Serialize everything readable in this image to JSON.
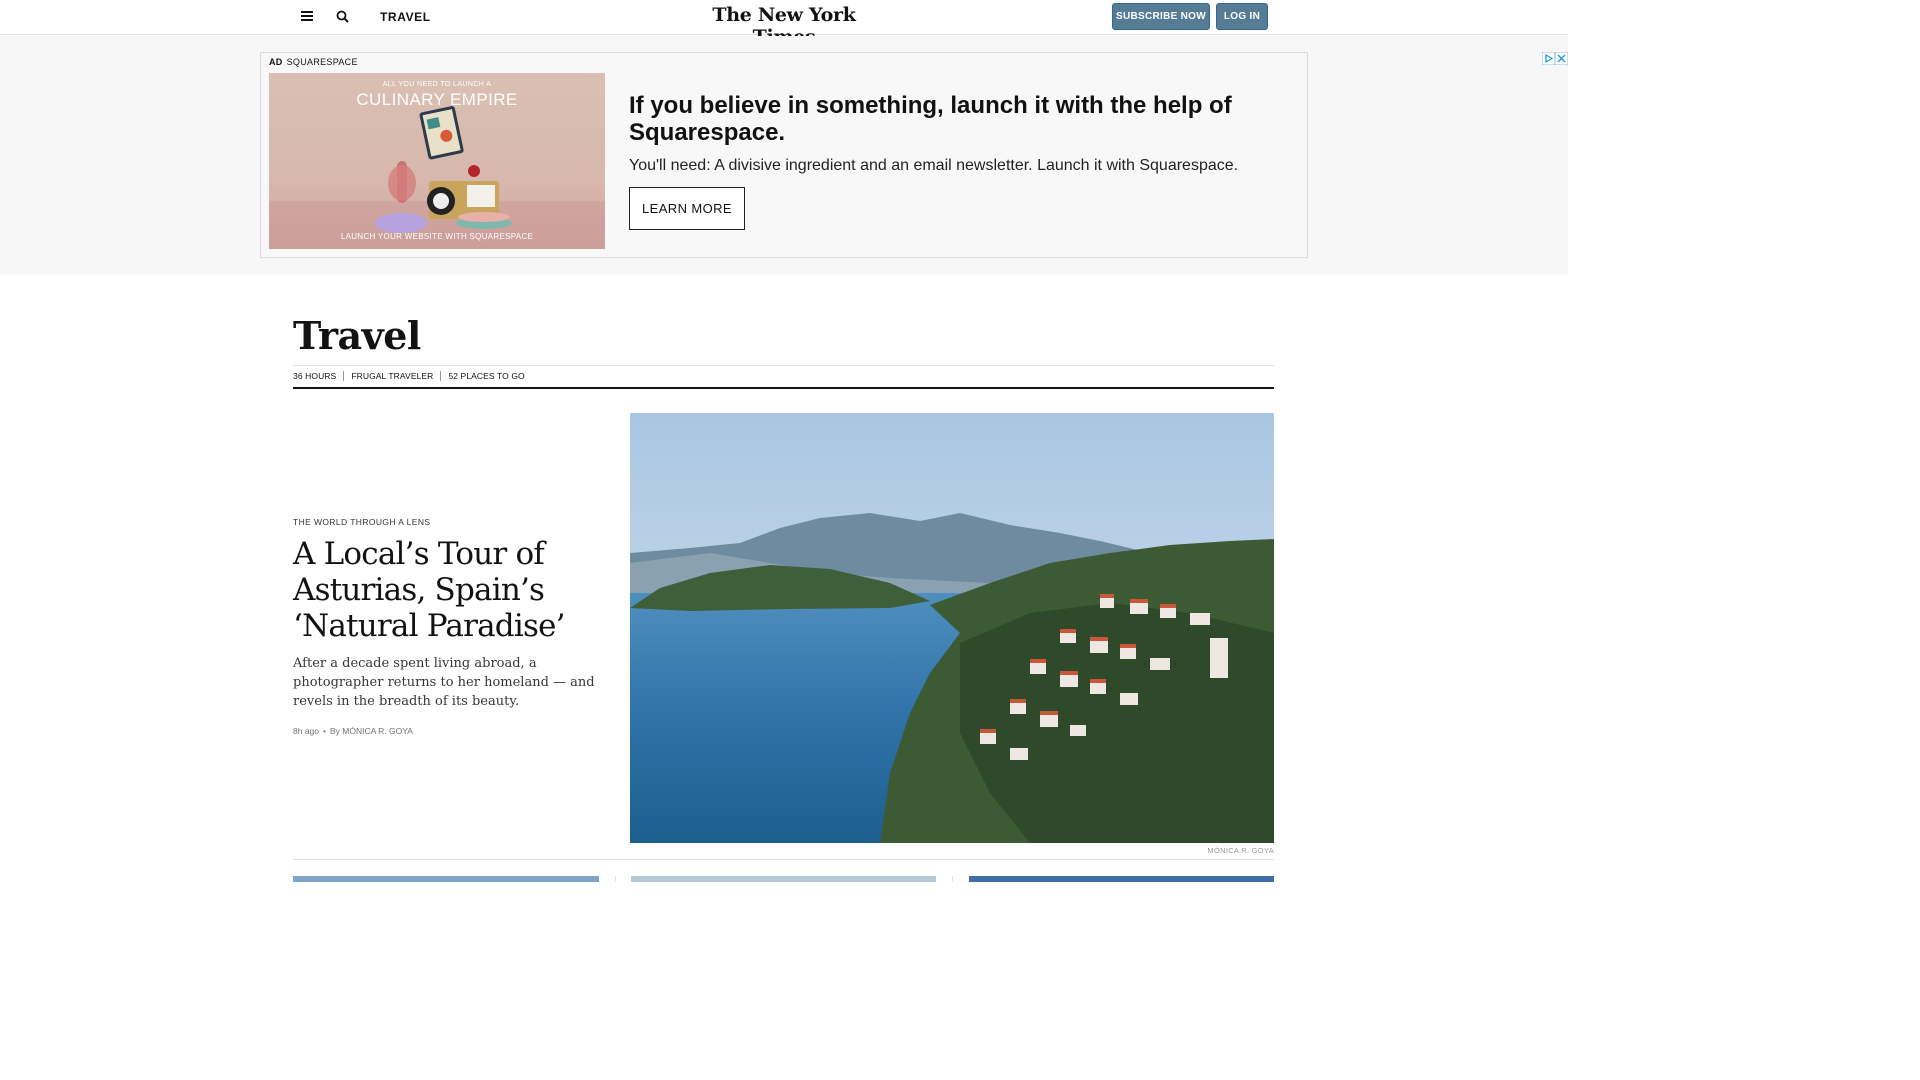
{
  "header": {
    "section_label": "TRAVEL",
    "masthead": "The New York Times",
    "subscribe_label": "SUBSCRIBE NOW",
    "login_label": "LOG IN",
    "icons": {
      "menu": "hamburger-menu-icon",
      "search": "search-icon"
    }
  },
  "ad": {
    "tag": "AD",
    "sponsor": "SQUARESPACE",
    "image_text": {
      "line1": "ALL YOU NEED TO LAUNCH A",
      "line2": "CULINARY EMPIRE",
      "line3": "LAUNCH YOUR WEBSITE WITH  SQUARESPACE"
    },
    "headline": "If you believe in something, launch it with the help of Squarespace.",
    "body": "You'll need: A divisive ingredient and an email newsletter. Launch it with Squarespace.",
    "cta": "LEARN MORE"
  },
  "section": {
    "title": "Travel",
    "subnav": [
      "36 HOURS",
      "FRUGAL TRAVELER",
      "52 PLACES TO GO"
    ]
  },
  "lead_story": {
    "kicker": "THE WORLD THROUGH A LENS",
    "headline": "A Local’s Tour of Asturias, Spain’s ‘Natural Paradise’",
    "summary": "After a decade spent living abroad, a photographer returns to her homeland — and revels in the breadth of its beauty.",
    "time": "8h ago",
    "byline": "By MÓNICA R. GOYA",
    "photo_credit": "MÓNICA R. GOYA"
  },
  "colors": {
    "button_blue": "#567b95",
    "ad_background": "#f7f7f7",
    "text": "#121212"
  }
}
